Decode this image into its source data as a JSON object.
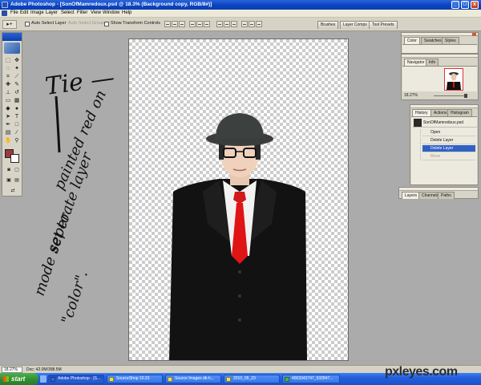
{
  "window": {
    "title": "Adobe Photoshop - [SonOfMamredoux.psd @ 18.3% (Background copy, RGB/8#)]",
    "controls": [
      "_",
      "□",
      "x"
    ]
  },
  "menubar": {
    "items": [
      "File",
      "Edit",
      "Image",
      "Layer",
      "Select",
      "Filter",
      "View",
      "Window",
      "Help"
    ]
  },
  "optionsbar": {
    "tool_preset": "▸+",
    "auto_select_layer": "Auto Select Layer",
    "auto_select_groups": "Auto Select Groups",
    "show_transform_controls": "Show Transform Controls",
    "palette_well_tabs": [
      "Brushes",
      "Layer Comps",
      "Tool Presets"
    ]
  },
  "toolbox": {
    "tools": [
      {
        "icon": "marquee-icon",
        "glyph": "⬚"
      },
      {
        "icon": "move-icon",
        "glyph": "✥"
      },
      {
        "icon": "lasso-icon",
        "glyph": "◌"
      },
      {
        "icon": "magic-wand-icon",
        "glyph": "✦"
      },
      {
        "icon": "crop-icon",
        "glyph": "⌗"
      },
      {
        "icon": "slice-icon",
        "glyph": "⟋"
      },
      {
        "icon": "healing-brush-icon",
        "glyph": "✚"
      },
      {
        "icon": "brush-icon",
        "glyph": "✎"
      },
      {
        "icon": "clone-stamp-icon",
        "glyph": "⊥"
      },
      {
        "icon": "history-brush-icon",
        "glyph": "↺"
      },
      {
        "icon": "eraser-icon",
        "glyph": "▭"
      },
      {
        "icon": "gradient-icon",
        "glyph": "▦"
      },
      {
        "icon": "blur-icon",
        "glyph": "◆"
      },
      {
        "icon": "dodge-icon",
        "glyph": "●"
      },
      {
        "icon": "path-selection-icon",
        "glyph": "➤"
      },
      {
        "icon": "type-icon",
        "glyph": "T"
      },
      {
        "icon": "pen-icon",
        "glyph": "✒"
      },
      {
        "icon": "shape-icon",
        "glyph": "□"
      },
      {
        "icon": "notes-icon",
        "glyph": "▤"
      },
      {
        "icon": "eyedropper-icon",
        "glyph": "⁄"
      },
      {
        "icon": "hand-icon",
        "glyph": "✋"
      },
      {
        "icon": "zoom-icon",
        "glyph": "⚲"
      }
    ],
    "foreground_color": "#9c3b3b",
    "background_color": "#ffffff"
  },
  "annotation": {
    "line1": "Tie —",
    "line2": "painted red on",
    "line3": "seperate layer",
    "line4": "mode set to",
    "line5": "\"color\"."
  },
  "statusbar": {
    "zoom": "18.27%",
    "doc_size": "Doc: 42.0M/398.5M"
  },
  "palettes": {
    "color": {
      "tabs": [
        "Color",
        "Swatches",
        "Styles"
      ]
    },
    "navigator": {
      "tabs": [
        "Navigator",
        "Info"
      ],
      "zoom": "18.27%"
    },
    "history": {
      "tabs": [
        "History",
        "Actions",
        "Histogram"
      ],
      "snapshot": "SonOfMamredoux.psd",
      "rows": [
        "Open",
        "Delete Layer",
        "Delete Layer",
        "Move"
      ],
      "active_index": 2
    },
    "layers": {
      "tabs": [
        "Layers",
        "Channels",
        "Paths"
      ]
    }
  },
  "taskbar": {
    "start_label": "start",
    "tasks": [
      "Adobe Photoshop - [S...",
      "SourceShop 10.23",
      "Source Images dk-h...",
      "2010_05_23",
      "4003342747_532847..."
    ]
  },
  "watermark": "pxleyes.com"
}
